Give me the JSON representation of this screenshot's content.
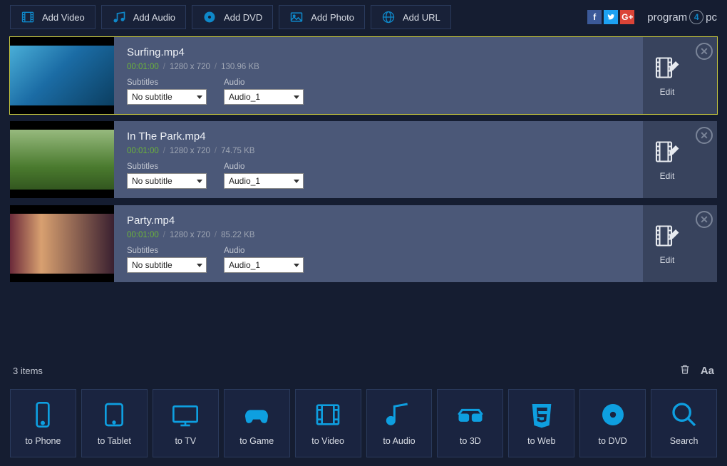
{
  "toolbar": {
    "add_video": "Add Video",
    "add_audio": "Add Audio",
    "add_dvd": "Add DVD",
    "add_photo": "Add Photo",
    "add_url": "Add URL"
  },
  "brand": {
    "p1": "program",
    "p2": "4",
    "p3": "pc"
  },
  "items": [
    {
      "name": "Surfing.mp4",
      "duration": "00:01:00",
      "dimensions": "1280 x 720",
      "size": "130.96 KB",
      "subtitle_label": "Subtitles",
      "subtitle_value": "No subtitle",
      "audio_label": "Audio",
      "audio_value": "Audio_1",
      "edit": "Edit",
      "selected": true
    },
    {
      "name": "In The Park.mp4",
      "duration": "00:01:00",
      "dimensions": "1280 x 720",
      "size": "74.75 KB",
      "subtitle_label": "Subtitles",
      "subtitle_value": "No subtitle",
      "audio_label": "Audio",
      "audio_value": "Audio_1",
      "edit": "Edit",
      "selected": false
    },
    {
      "name": "Party.mp4",
      "duration": "00:01:00",
      "dimensions": "1280 x 720",
      "size": "85.22 KB",
      "subtitle_label": "Subtitles",
      "subtitle_value": "No subtitle",
      "audio_label": "Audio",
      "audio_value": "Audio_1",
      "edit": "Edit",
      "selected": false
    }
  ],
  "status": {
    "count": "3  items"
  },
  "targets": {
    "phone": "to Phone",
    "tablet": "to Tablet",
    "tv": "to TV",
    "game": "to Game",
    "video": "to Video",
    "audio": "to Audio",
    "threed": "to 3D",
    "web": "to Web",
    "dvd": "to DVD",
    "search": "Search"
  }
}
